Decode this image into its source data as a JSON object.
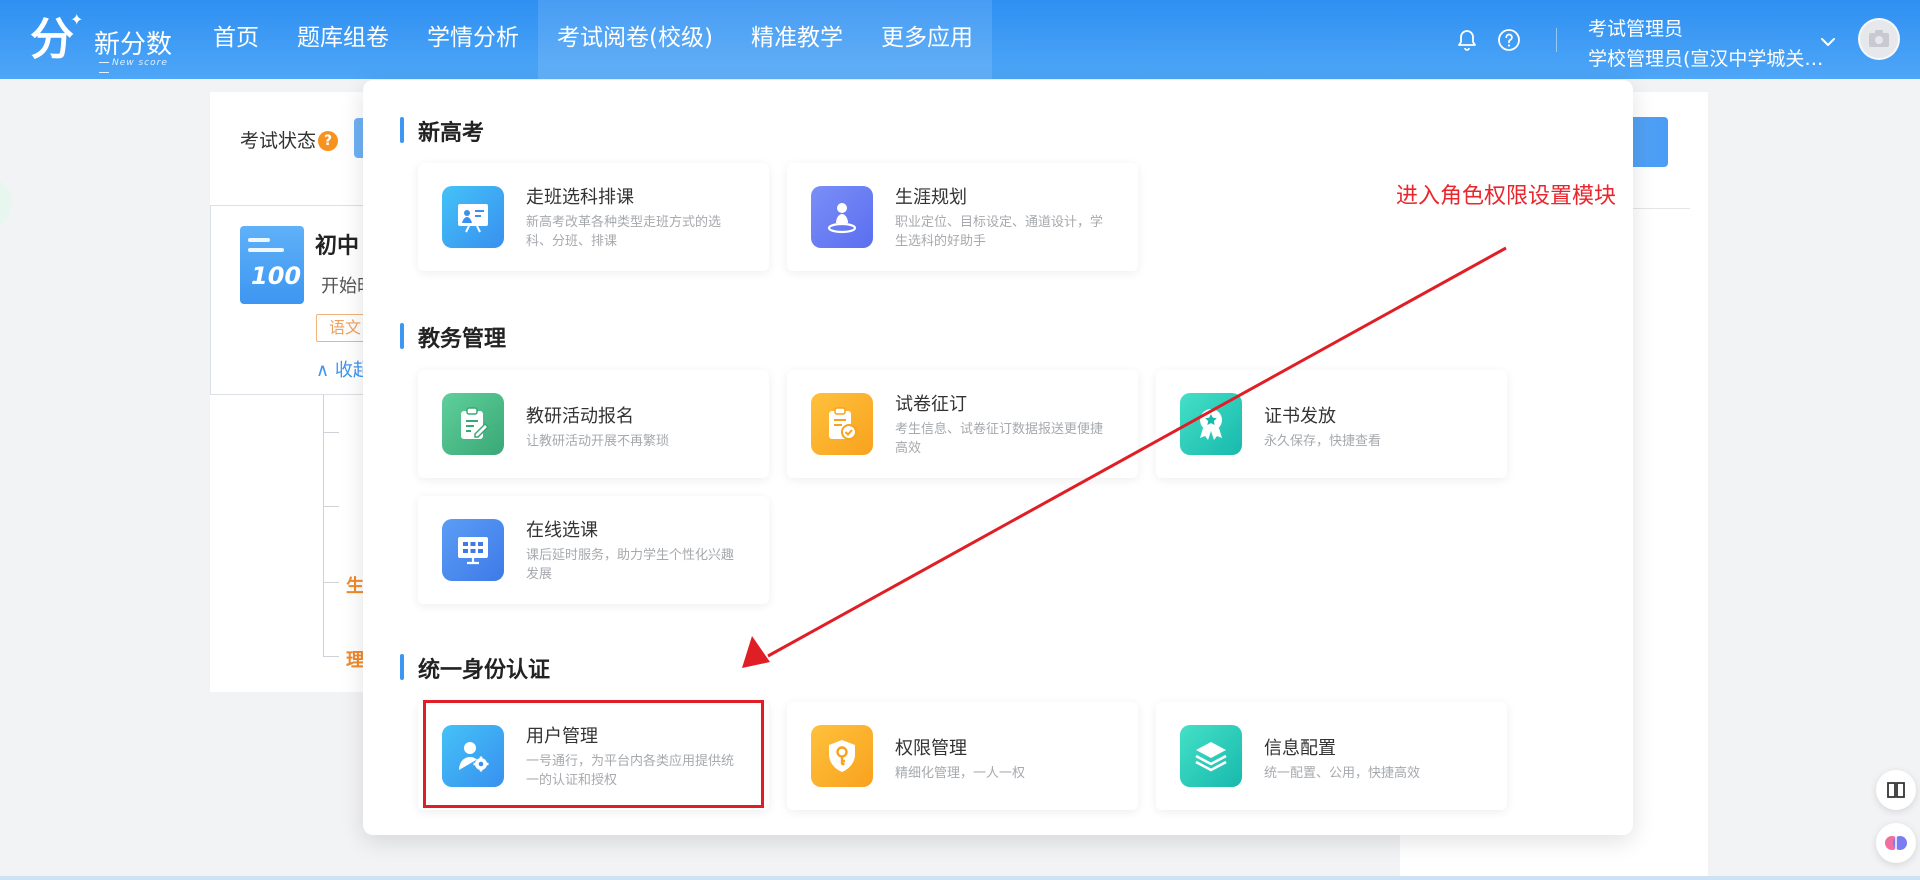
{
  "header": {
    "logo": {
      "name": "新分数",
      "subtitle": "New score"
    },
    "nav": [
      {
        "label": "首页"
      },
      {
        "label": "题库组卷"
      },
      {
        "label": "学情分析"
      },
      {
        "label": "考试阅卷(校级)"
      },
      {
        "label": "精准教学"
      },
      {
        "label": "更多应用"
      }
    ],
    "user": {
      "name": "考试管理员",
      "role": "学校管理员(宣汉中学城关校区)"
    }
  },
  "background": {
    "filter_label": "考试状态",
    "filter_help": "?",
    "exam_title": "初中",
    "exam_status": "开始时",
    "subject_tag": "语文",
    "collapse_label": "收起",
    "tree_items": [
      "生",
      "理"
    ]
  },
  "panel": {
    "sections": [
      {
        "title": "新高考",
        "apps": [
          {
            "name": "走班选科排课",
            "desc": "新高考改革各种类型走班方式的选科、分班、排课",
            "icon": "classroom-board-icon"
          },
          {
            "name": "生涯规划",
            "desc": "职业定位、目标设定、通道设计，学生选科的好助手",
            "icon": "career-location-icon"
          }
        ]
      },
      {
        "title": "教务管理",
        "apps": [
          {
            "name": "教研活动报名",
            "desc": "让教研活动开展不再繁琐",
            "icon": "clipboard-edit-icon"
          },
          {
            "name": "试卷征订",
            "desc": "考生信息、试卷征订数据报送更便捷高效",
            "icon": "paper-order-icon"
          },
          {
            "name": "证书发放",
            "desc": "永久保存，快捷查看",
            "icon": "certificate-medal-icon"
          },
          {
            "name": "在线选课",
            "desc": "课后延时服务，助力学生个性化兴趣发展",
            "icon": "online-course-icon"
          }
        ]
      },
      {
        "title": "统一身份认证",
        "apps": [
          {
            "name": "用户管理",
            "desc": "一号通行，为平台内各类应用提供统一的认证和授权",
            "icon": "user-settings-icon"
          },
          {
            "name": "权限管理",
            "desc": "精细化管理，一人一权",
            "icon": "permission-key-icon"
          },
          {
            "name": "信息配置",
            "desc": "统一配置、公用，快捷高效",
            "icon": "layers-icon"
          }
        ]
      }
    ]
  },
  "annotation": {
    "text": "进入角色权限设置模块"
  },
  "colors": {
    "primary": "#3d96f1",
    "annotation_red": "#e8262d",
    "tag_orange": "#f0a25c"
  }
}
